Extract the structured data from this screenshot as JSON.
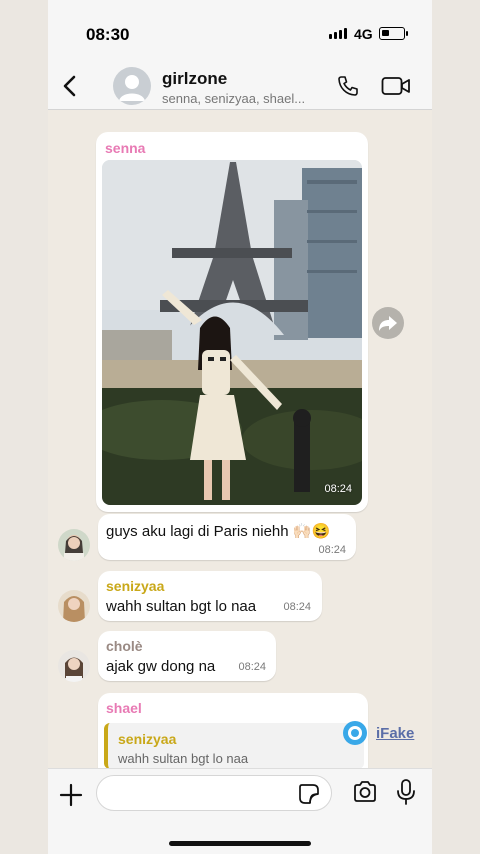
{
  "status_bar": {
    "time": "08:30",
    "network": "4G"
  },
  "header": {
    "group_name": "girlzone",
    "members": "senna, senizyaa, shael..."
  },
  "messages": [
    {
      "sender": "senna",
      "sender_color": "#e87ab4",
      "type": "photo",
      "time": "08:24"
    },
    {
      "sender": "",
      "text": "guys aku lagi di Paris niehh 🙌🏻😆",
      "time": "08:24"
    },
    {
      "sender": "senizyaa",
      "sender_color": "#c9a819",
      "text": "wahh sultan bgt lo naa",
      "time": "08:24"
    },
    {
      "sender": "cholè",
      "sender_color": "#9a8a84",
      "text": "ajak gw dong na",
      "time": "08:24"
    },
    {
      "sender": "shael",
      "sender_color": "#e87ab4",
      "reply_to": {
        "sender": "senizyaa",
        "text": "wahh sultan bgt lo naa"
      }
    }
  ],
  "watermark": {
    "label": "iFake"
  },
  "input": {
    "value": "",
    "placeholder": ""
  },
  "icons": [
    "back-icon",
    "group-avatar-icon",
    "phone-call-icon",
    "video-call-icon",
    "forward-icon",
    "plus-icon",
    "sticker-icon",
    "camera-icon",
    "microphone-icon"
  ],
  "colors": {
    "bar_bg": "#f6f6f6",
    "chat_bg": "#efeae2",
    "bubble": "#ffffff",
    "pink_name": "#e87ab4",
    "gold_name": "#c9a819"
  }
}
